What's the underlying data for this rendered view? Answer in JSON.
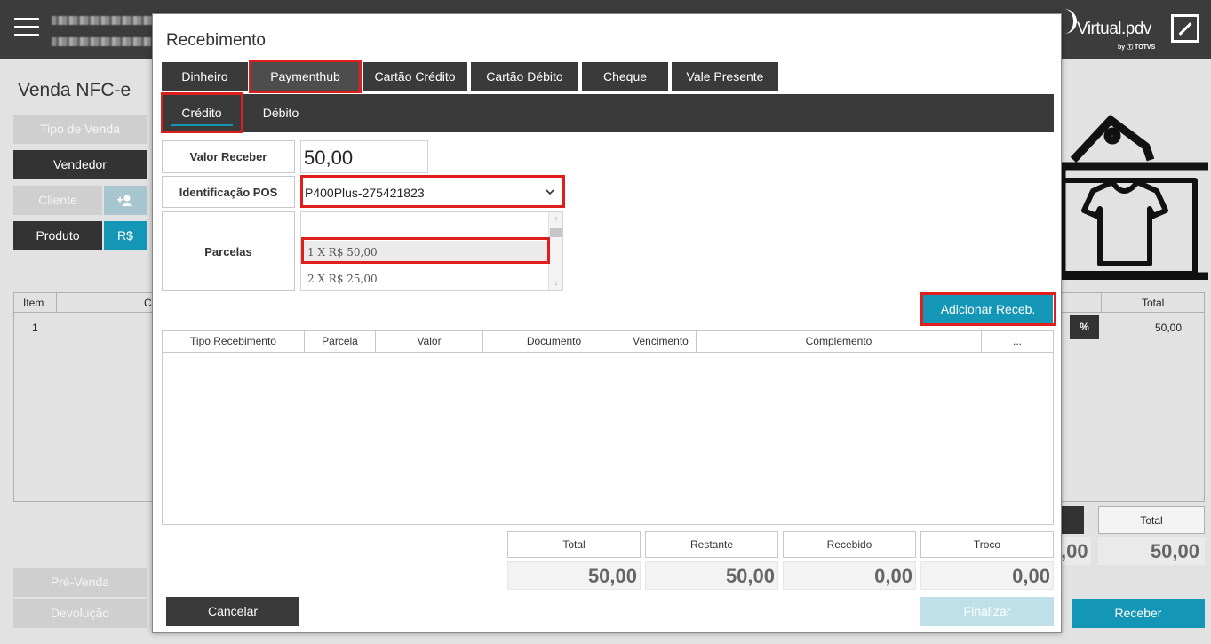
{
  "app": {
    "brand": "Virtual.pdv",
    "brand_by": "by Ⓣ TOTVS",
    "page_title": "Venda NFC-e",
    "sidebar": {
      "tipo_venda": "Tipo de Venda",
      "vendedor": "Vendedor",
      "cliente": "Cliente",
      "produto": "Produto",
      "moeda": "R$",
      "pre_venda": "Pré-Venda",
      "devolucao": "Devolução"
    },
    "items_table": {
      "col_item": "Item",
      "col_c": "C",
      "row_item": "1"
    },
    "right_panel": {
      "col_total": "Total",
      "percent": "%",
      "row_total": "50,00",
      "total_label": "Total",
      "total_value": "50,00",
      "partial_value": ",00"
    },
    "receber": "Receber"
  },
  "modal": {
    "title": "Recebimento",
    "tabs": [
      "Dinheiro",
      "Paymenthub",
      "Cartão Crédito",
      "Cartão Débito",
      "Cheque",
      "Vale Presente"
    ],
    "active_tab": "Paymenthub",
    "subtabs": [
      "Crédito",
      "Débito"
    ],
    "active_subtab": "Crédito",
    "fields": {
      "valor_receber_label": "Valor Receber",
      "valor_receber_value": "50,00",
      "identificacao_pos_label": "Identificação POS",
      "identificacao_pos_value": "P400Plus-275421823",
      "parcelas_label": "Parcelas",
      "parcelas_options": [
        "1 X R$ 50,00",
        "2 X R$ 25,00"
      ],
      "parcelas_selected": "1 X R$ 50,00"
    },
    "add_button": "Adicionar Receb.",
    "grid_columns": [
      "Tipo Recebimento",
      "Parcela",
      "Valor",
      "Documento",
      "Vencimento",
      "Complemento",
      "..."
    ],
    "summary": {
      "labels": [
        "Total",
        "Restante",
        "Recebido",
        "Troco"
      ],
      "values": [
        "50,00",
        "50,00",
        "0,00",
        "0,00"
      ]
    },
    "cancel_button": "Cancelar",
    "finalize_button": "Finalizar"
  },
  "colors": {
    "accent": "#1497b7",
    "dark": "#3a3a3a",
    "highlight": "#e01e1e"
  },
  "icons": [
    "hamburger-icon",
    "expand-icon",
    "add-user-icon",
    "chevron-down-icon",
    "shirt-tag-icon"
  ]
}
